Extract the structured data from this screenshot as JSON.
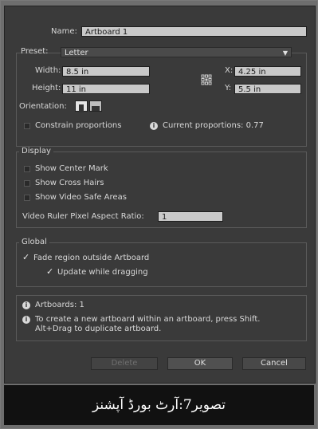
{
  "name_label": "Name:",
  "name_value": "Artboard 1",
  "preset": {
    "label": "Preset:",
    "value": "Letter",
    "width_label": "Width:",
    "width_value": "8.5 in",
    "height_label": "Height:",
    "height_value": "11 in",
    "x_label": "X:",
    "x_value": "4.25 in",
    "y_label": "Y:",
    "y_value": "5.5 in",
    "orientation_label": "Orientation:",
    "constrain_label": "Constrain proportions",
    "current_proportions": "Current proportions: 0.77"
  },
  "display": {
    "title": "Display",
    "center_mark": "Show Center Mark",
    "cross_hairs": "Show Cross Hairs",
    "video_safe": "Show Video Safe Areas",
    "ratio_label": "Video Ruler Pixel Aspect Ratio:",
    "ratio_value": "1"
  },
  "global": {
    "title": "Global",
    "fade_region": "Fade region outside Artboard",
    "update_dragging": "Update while dragging"
  },
  "info": {
    "artboards": "Artboards: 1",
    "tip_line1": "To create a new artboard within an artboard, press Shift.",
    "tip_line2": "Alt+Drag to duplicate artboard."
  },
  "buttons": {
    "delete": "Delete",
    "ok": "OK",
    "cancel": "Cancel"
  },
  "caption": "تصویر7:آرٹ بورڈ آپشنز",
  "colors": {
    "dialog_bg": "#3a3a3a",
    "field_bg": "#c9c9c9",
    "caption_bg": "#111111"
  }
}
